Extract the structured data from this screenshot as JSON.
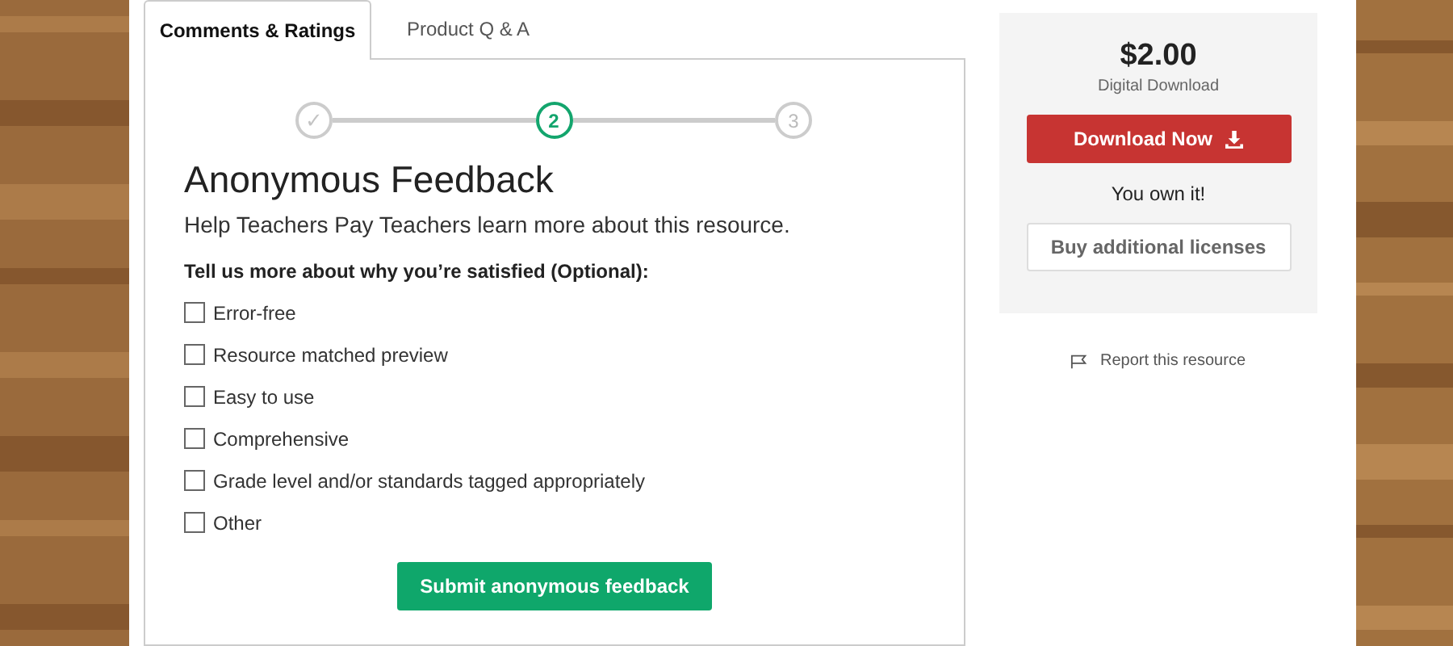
{
  "tabs": [
    {
      "label": "Comments & Ratings",
      "selected": true
    },
    {
      "label": "Product Q & A",
      "selected": false
    }
  ],
  "steps": [
    {
      "label": "✓",
      "completed": true,
      "selected": false
    },
    {
      "label": "2",
      "completed": false,
      "selected": true
    },
    {
      "label": "3",
      "completed": false,
      "selected": false
    }
  ],
  "heading": "Anonymous Feedback",
  "subheading": "Help Teachers Pay Teachers learn more about this resource.",
  "question": "Tell us more about why you’re satisfied (Optional):",
  "options": [
    {
      "label": "Error-free",
      "checked": false
    },
    {
      "label": "Resource matched preview",
      "checked": false
    },
    {
      "label": "Easy to use",
      "checked": false
    },
    {
      "label": "Comprehensive",
      "checked": false
    },
    {
      "label": "Grade level and/or standards tagged appropriately",
      "checked": false
    },
    {
      "label": "Other",
      "checked": false
    }
  ],
  "submit_button": "Submit anonymous feedback",
  "purchase": {
    "price": "$2.00",
    "format": "Digital Download",
    "download_button": "Download Now",
    "owned_note": "You own it!",
    "licenses_button": "Buy additional licenses"
  },
  "report_link": "Report this resource"
}
